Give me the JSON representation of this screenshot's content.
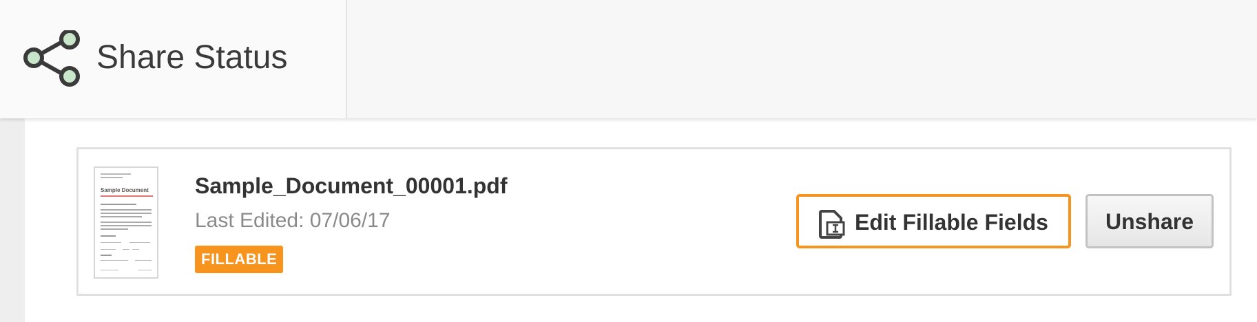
{
  "header": {
    "title": "Share Status",
    "icon": "share-icon",
    "icon_node_color": "#c8e6c9",
    "icon_stroke_color": "#3a3a3a"
  },
  "document": {
    "name": "Sample_Document_00001.pdf",
    "last_edited": "Last Edited: 07/06/17",
    "badge": "FILLABLE",
    "badge_color": "#f7941d",
    "thumbnail": {
      "title": "Sample Document"
    }
  },
  "actions": {
    "edit_fillable_label": "Edit Fillable Fields",
    "edit_fillable_icon": "fillable-document-icon",
    "edit_fillable_border_color": "#f7941d",
    "unshare_label": "Unshare"
  }
}
